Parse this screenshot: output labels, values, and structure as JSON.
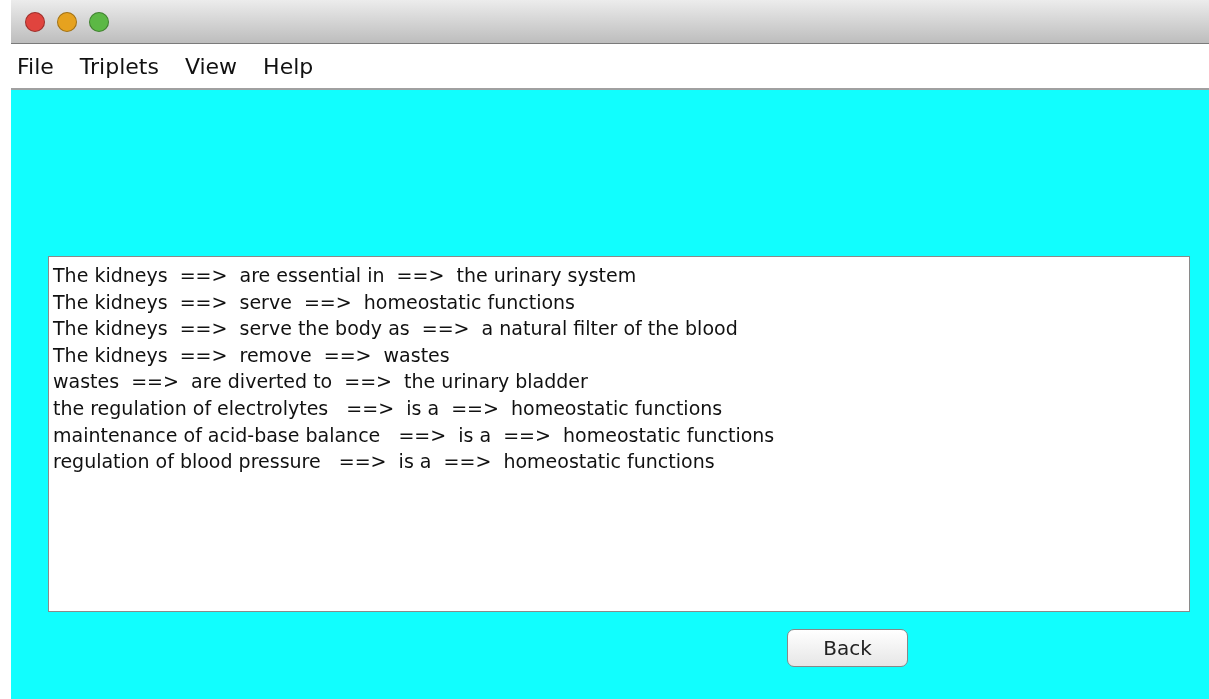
{
  "window": {
    "buttons": [
      {
        "color": "#e0443e"
      },
      {
        "color": "#e6a21f"
      },
      {
        "color": "#5cb845"
      }
    ]
  },
  "menu": [
    "File",
    "Triplets",
    "View",
    "Help"
  ],
  "text_area": {
    "lines": [
      "The kidneys  ==>  are essential in  ==>  the urinary system",
      "The kidneys  ==>  serve  ==>  homeostatic functions",
      "The kidneys  ==>  serve the body as  ==>  a natural filter of the blood",
      "The kidneys  ==>  remove  ==>  wastes",
      "wastes  ==>  are diverted to  ==>  the urinary bladder",
      "the regulation of electrolytes   ==>  is a  ==>  homeostatic functions",
      "maintenance of acid-base balance   ==>  is a  ==>  homeostatic functions",
      "regulation of blood pressure   ==>  is a  ==>  homeostatic functions"
    ]
  },
  "buttons": [
    "Back"
  ]
}
